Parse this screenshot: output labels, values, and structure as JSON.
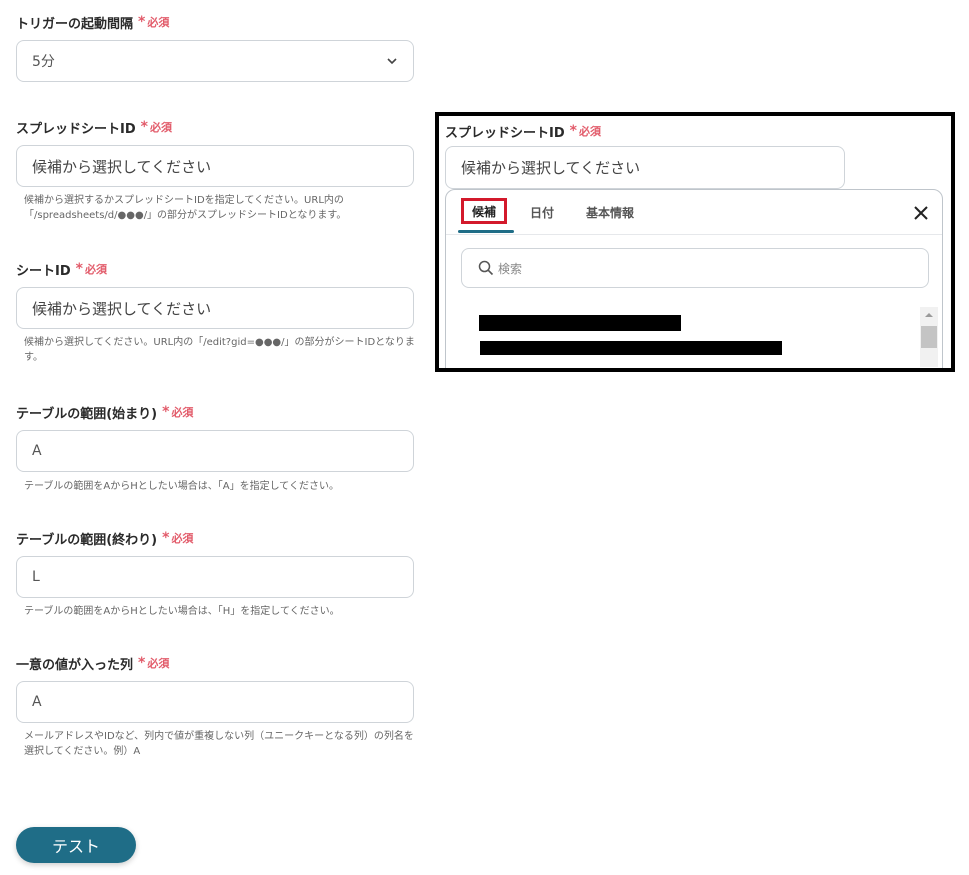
{
  "required_text": "必須",
  "fields": {
    "interval": {
      "label": "トリガーの起動間隔",
      "value": "5分"
    },
    "spreadsheet": {
      "label": "スプレッドシートID",
      "placeholder": "候補から選択してください",
      "hint": "候補から選択するかスプレッドシートIDを指定してください。URL内の「/spreadsheets/d/●●●/」の部分がスプレッドシートIDとなります。"
    },
    "sheet": {
      "label": "シートID",
      "placeholder": "候補から選択してください",
      "hint": "候補から選択してください。URL内の「/edit?gid=●●●/」の部分がシートIDとなります。"
    },
    "range_start": {
      "label": "テーブルの範囲(始まり)",
      "value": "A",
      "hint": "テーブルの範囲をAからHとしたい場合は、「A」を指定してください。"
    },
    "range_end": {
      "label": "テーブルの範囲(終わり)",
      "value": "L",
      "hint": "テーブルの範囲をAからHとしたい場合は、「H」を指定してください。"
    },
    "unique_col": {
      "label": "一意の値が入った列",
      "value": "A",
      "hint": "メールアドレスやIDなど、列内で値が重複しない列（ユニークキーとなる列）の列名を選択してください。例）A"
    }
  },
  "test_button": "テスト",
  "zoom_panel": {
    "label": "スプレッドシートID",
    "placeholder": "候補から選択してください",
    "tabs": [
      "候補",
      "日付",
      "基本情報"
    ],
    "search_placeholder": "検索"
  },
  "colors": {
    "accent": "#1f6d87",
    "required": "#e25b6a",
    "highlight": "#d3192b"
  }
}
